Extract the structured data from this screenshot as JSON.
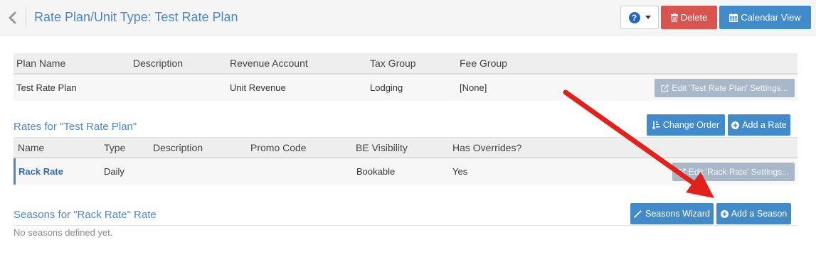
{
  "header": {
    "title": "Rate Plan/Unit Type: Test Rate Plan",
    "delete_label": "Delete",
    "calendar_label": "Calendar View",
    "help_label": "?"
  },
  "plan_table": {
    "columns": [
      "Plan Name",
      "Description",
      "Revenue Account",
      "Tax Group",
      "Fee Group"
    ],
    "row": {
      "plan_name": "Test Rate Plan",
      "description": "",
      "revenue_account": "Unit Revenue",
      "tax_group": "Lodging",
      "fee_group": "[None]"
    },
    "edit_label": "Edit 'Test Rate Plan' Settings..."
  },
  "rates_section": {
    "title": "Rates for \"Test Rate Plan\"",
    "change_order_label": "Change Order",
    "add_rate_label": "Add a Rate",
    "columns": [
      "Name",
      "Type",
      "Description",
      "Promo Code",
      "BE Visibility",
      "Has Overrides?"
    ],
    "row": {
      "name": "Rack Rate",
      "type": "Daily",
      "description": "",
      "promo_code": "",
      "be_visibility": "Bookable",
      "has_overrides": "Yes"
    },
    "edit_label": "Edit 'Rack Rate' Settings..."
  },
  "seasons_section": {
    "title": "Seasons for \"Rack Rate\" Rate",
    "wizard_label": "Seasons Wizard",
    "add_season_label": "Add a Season",
    "empty_message": "No seasons defined yet."
  },
  "colors": {
    "primary": "#428bca",
    "danger": "#d9534f",
    "title": "#4f86c6",
    "annotation_arrow": "#e3211c"
  },
  "icons": [
    "chevron-left-icon",
    "question-icon",
    "trash-icon",
    "calendar-icon",
    "edit-icon",
    "sort-icon",
    "plus-circle-icon",
    "magic-wand-icon"
  ]
}
